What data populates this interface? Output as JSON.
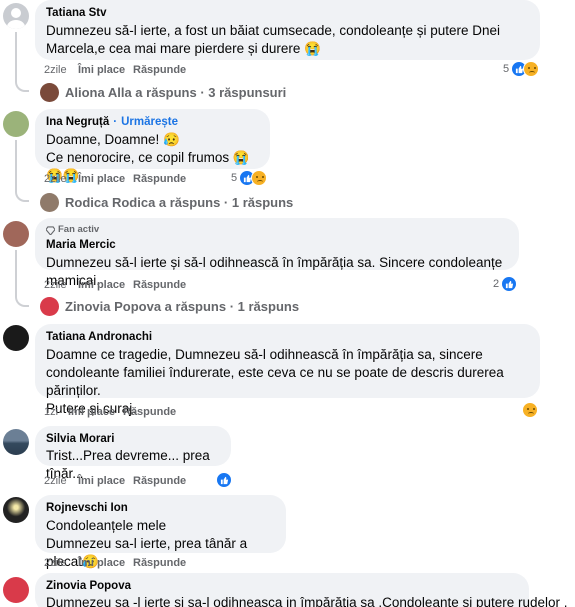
{
  "comments": [
    {
      "author": "Tatiana Stv",
      "text": "Dumnezeu să-l ierte, a fost un băiat cumsecade, condoleanțe și putere Dnei Marcela,e cea mai mare pierdere și durere 😭",
      "time": "2zile",
      "like": "Îmi place",
      "reply": "Răspunde",
      "reaction_count": "5",
      "replies_summary": "Aliona Alla a răspuns · 3 răspunsuri"
    },
    {
      "author": "Ina Negruță",
      "follow": "Urmărește",
      "text_line1": "Doamne, Doamne! 😥",
      "text_line2": "Ce nenorocire, ce copil frumos 😭😭😭",
      "time": "2zile",
      "like": "Îmi place",
      "reply": "Răspunde",
      "reaction_count": "5",
      "replies_summary": "Rodica Rodica a răspuns · 1 răspuns"
    },
    {
      "badge": "Fan activ",
      "author": "Maria Mercic",
      "text": "Dumnezeu să-l ierte și să-l odihnească în împărăția sa. Sincere condoleanțe mamicai.",
      "time": "2zile",
      "like": "Îmi place",
      "reply": "Răspunde",
      "reaction_count": "2",
      "replies_summary": "Zinovia Popova a răspuns · 1 răspuns"
    },
    {
      "author": "Tatiana Andronachi",
      "text": "Doamne ce tragedie, Dumnezeu să-l odihnească în împărăția sa, sincere condoleante familiei îndurerate, este ceva ce nu se poate de descris durerea părinților.\nPutere și curaj.",
      "time": "1zi",
      "like": "Îmi place",
      "reply": "Răspunde"
    },
    {
      "author": "Silvia Morari",
      "text": "Trist...Prea devreme... prea tînăr...",
      "time": "2zile",
      "like": "Îmi place",
      "reply": "Răspunde"
    },
    {
      "author": "Rojnevschi Ion",
      "text": "Condoleanțele mele\nDumnezeu sa-l ierte, prea tânăr a plecat😥",
      "time": "2zile",
      "like": "Îmi place",
      "reply": "Răspunde"
    },
    {
      "author": "Zinovia Popova",
      "text": "Dumnezeu sa -l ierte și sa-l odihneasca in împărăția sa .Condoleanțe și putere rudelor ."
    }
  ],
  "colors": {
    "bubble": "#f0f2f5",
    "meta": "#65676b",
    "link": "#1b74e4",
    "like": "#1877f2",
    "sad": "#f7b125"
  }
}
